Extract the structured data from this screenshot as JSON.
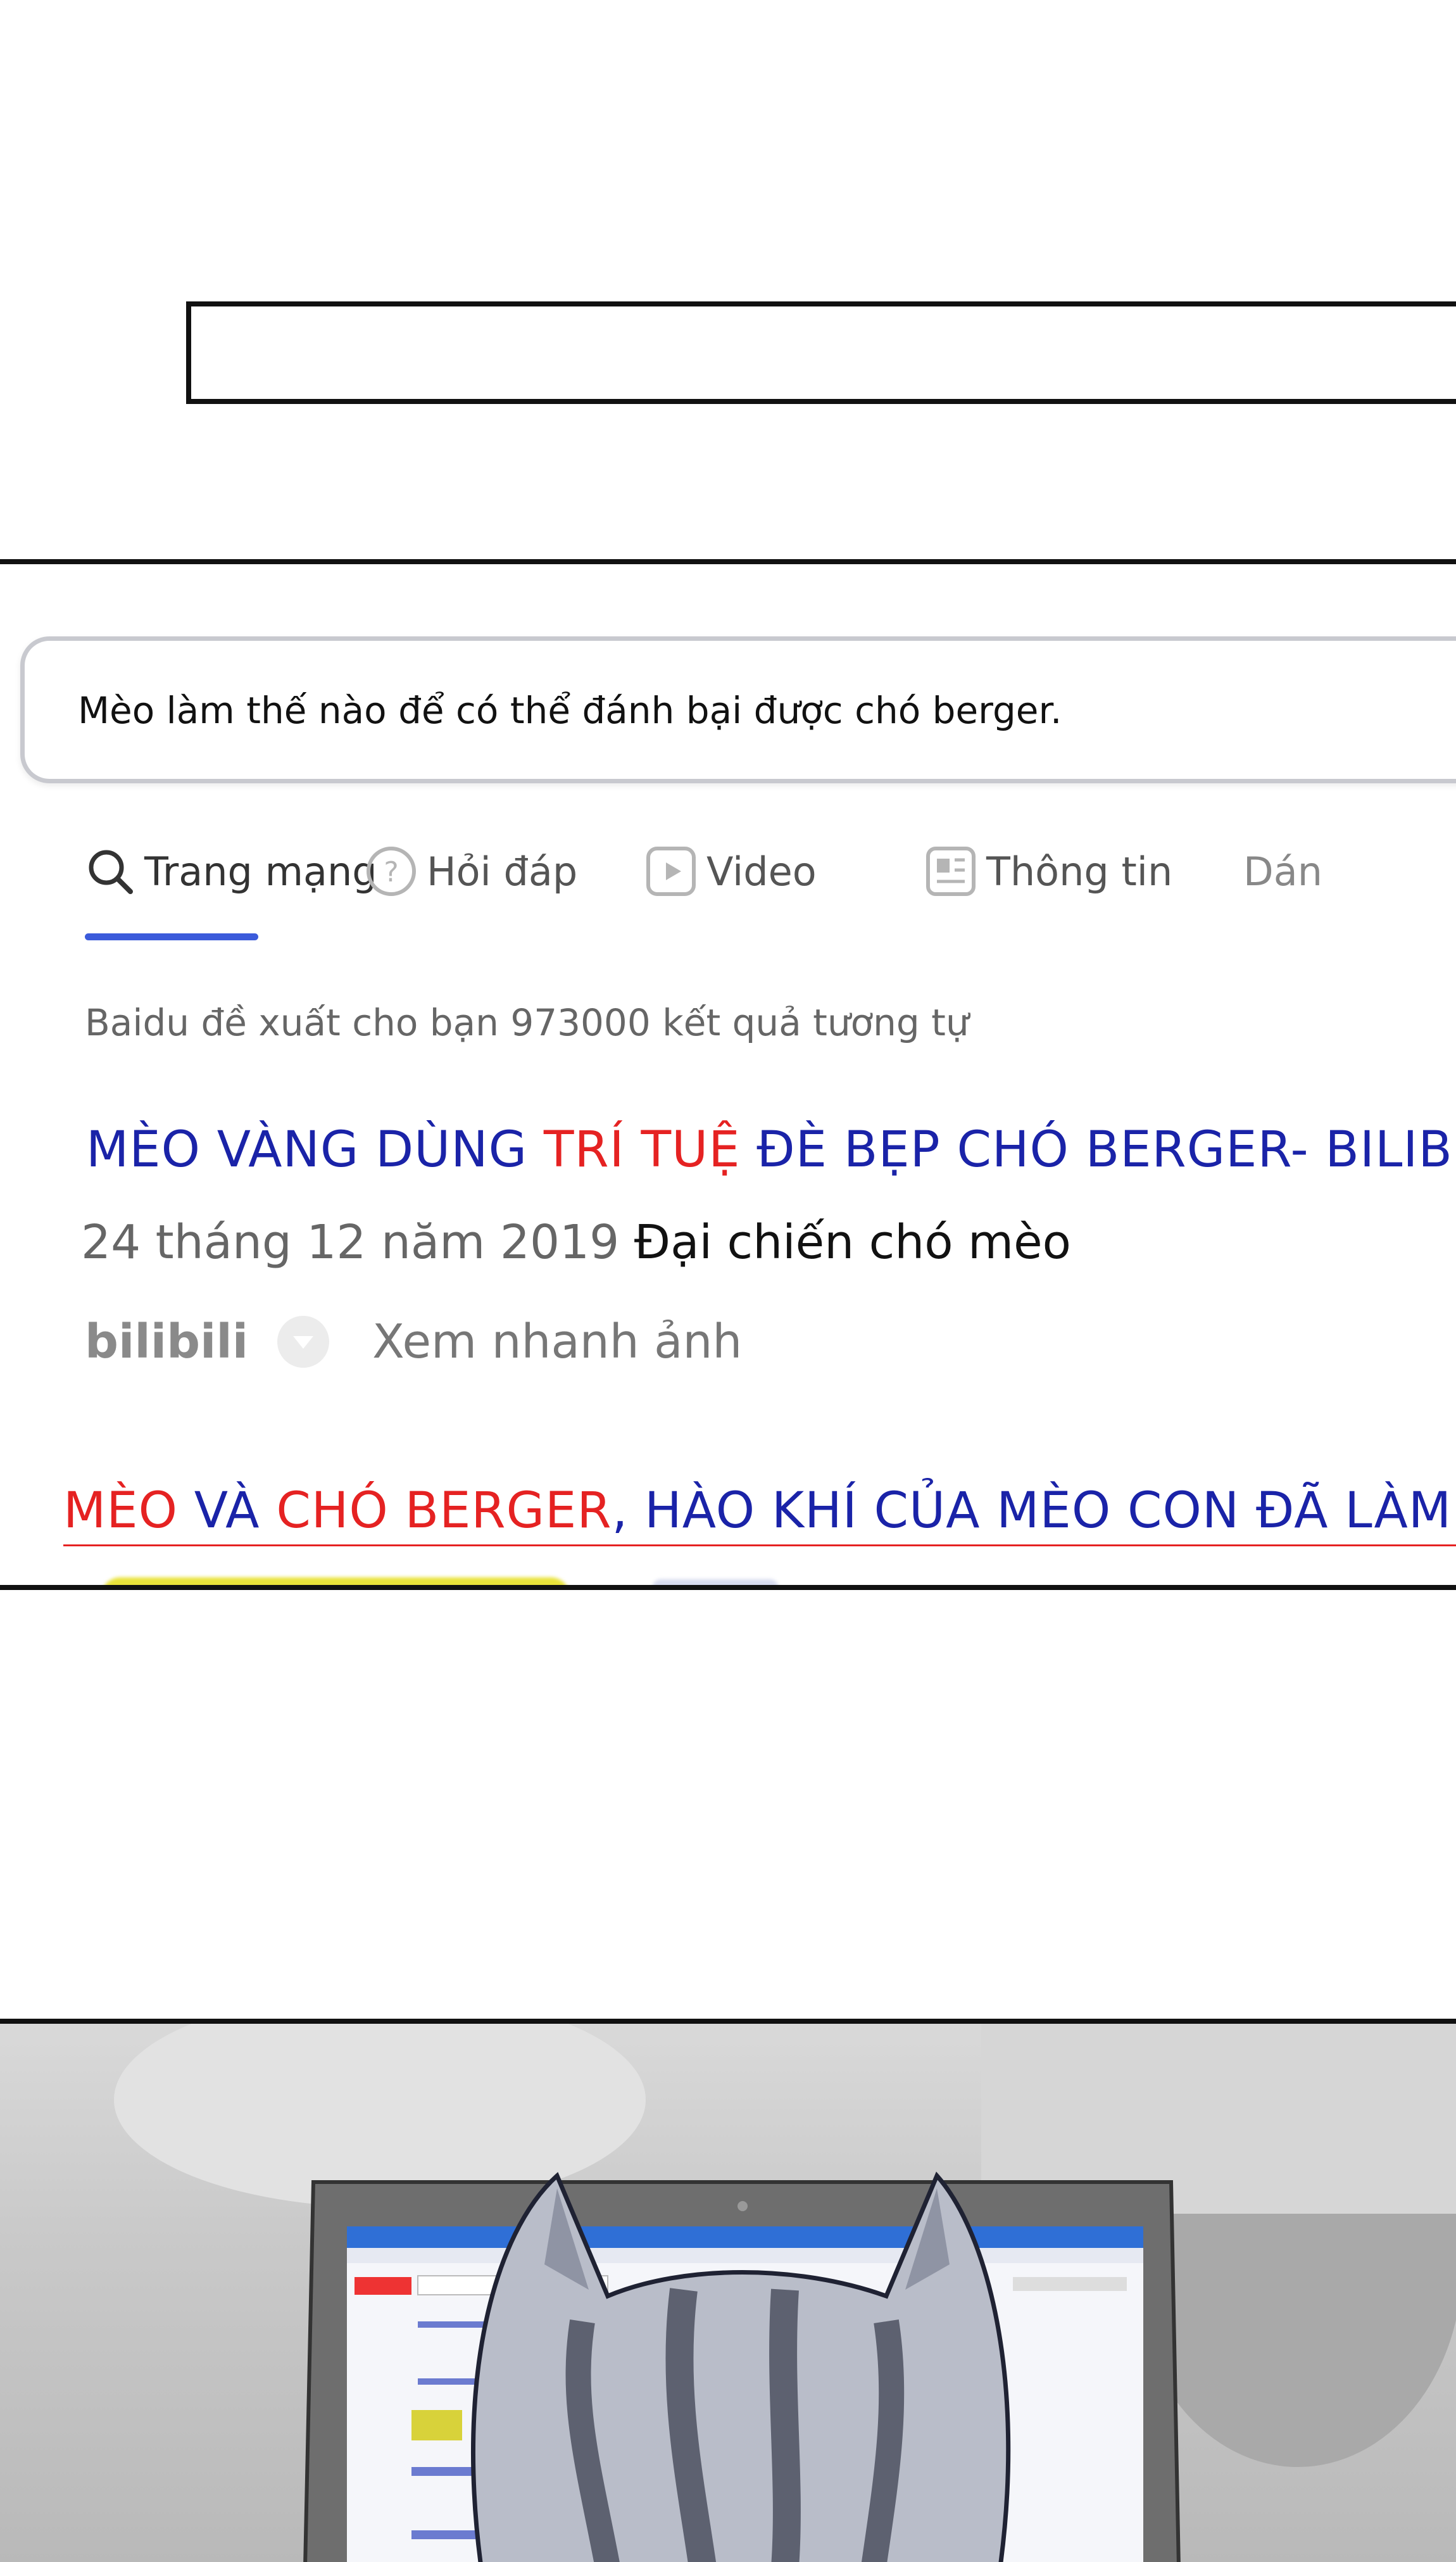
{
  "search": {
    "query": "Mèo làm thế nào để có thể đánh bại được chó berger."
  },
  "tabs": [
    {
      "label": "Trang mạng",
      "icon": "search-icon",
      "active": true
    },
    {
      "label": "Hỏi đáp",
      "icon": "question-icon",
      "active": false
    },
    {
      "label": "Video",
      "icon": "video-icon",
      "active": false
    },
    {
      "label": "Thông tin",
      "icon": "news-icon",
      "active": false
    },
    {
      "label": "Dán",
      "icon": "",
      "active": false
    }
  ],
  "results_summary": "Baidu đề xuất cho bạn 973000 kết quả tương tự",
  "result1": {
    "title_part1": "MÈO VÀNG DÙNG ",
    "title_part2": "TRÍ TUỆ",
    "title_part3": " ĐÈ BẸP CHÓ BERGER- BILIBILI",
    "date": "24 tháng 12 năm 2019",
    "category": "Đại chiến chó mèo",
    "source": "bilibili",
    "quick_view": "Xem nhanh ảnh"
  },
  "result2": {
    "title_part1": "MÈO",
    "title_part2": " VÀ ",
    "title_part3": "CHÓ BERGER",
    "title_part4": ", HÀO KHÍ CỦA MÈO CON ĐÃ LÀM CON C"
  },
  "colors": {
    "title_blue": "#1a23a8",
    "highlight_red": "#e52222",
    "tab_active": "#3b5bdb"
  }
}
